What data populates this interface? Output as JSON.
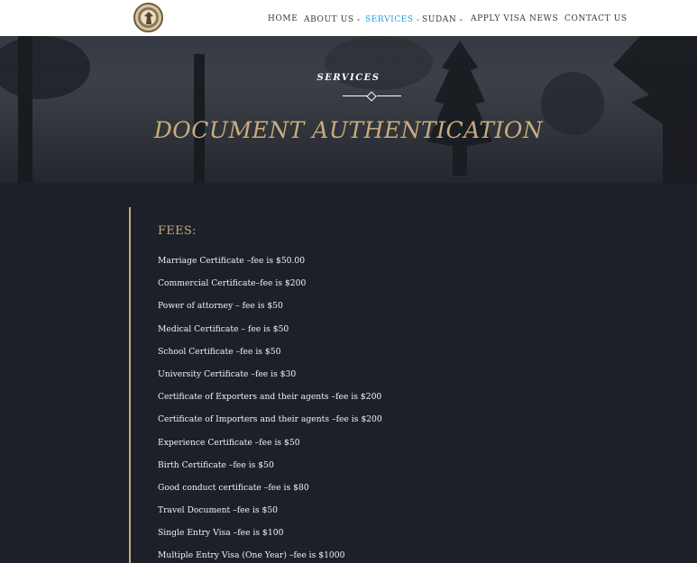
{
  "nav": {
    "items": [
      {
        "label": "HOME",
        "dropdown": false,
        "active": false
      },
      {
        "label": "ABOUT US",
        "dropdown": true,
        "active": false
      },
      {
        "label": "SERVICES",
        "dropdown": true,
        "active": true
      },
      {
        "label": "SUDAN",
        "dropdown": true,
        "active": false
      },
      {
        "label": "APPLY VISA",
        "dropdown": false,
        "active": false
      },
      {
        "label": "NEWS",
        "dropdown": false,
        "active": false
      },
      {
        "label": "CONTACT US",
        "dropdown": false,
        "active": false
      }
    ]
  },
  "hero": {
    "subtitle": "SERVICES",
    "title": "DOCUMENT AUTHENTICATION"
  },
  "fees": {
    "heading": "FEES:",
    "items": [
      "Marriage Certificate –fee is $50.00",
      "Commercial Certificate–fee is $200",
      "Power of attorney  –  fee is $50",
      "Medical Certificate  –  fee is $50",
      "School Certificate –fee is $50",
      "University Certificate –fee is $30",
      "Certificate of Exporters and their agents –fee is $200",
      "Certificate of Importers and their agents –fee is $200",
      "Experience Certificate –fee is $50",
      "Birth Certificate –fee is $50",
      "Good conduct certificate –fee is $80",
      "Travel Document –fee is $50",
      "Single Entry Visa –fee is $100",
      "Multiple Entry Visa (One Year) –fee is $1000"
    ]
  },
  "colors": {
    "accent_gold": "#c9ab7e",
    "nav_active": "#2a9bd6",
    "background": "#1d2028"
  }
}
